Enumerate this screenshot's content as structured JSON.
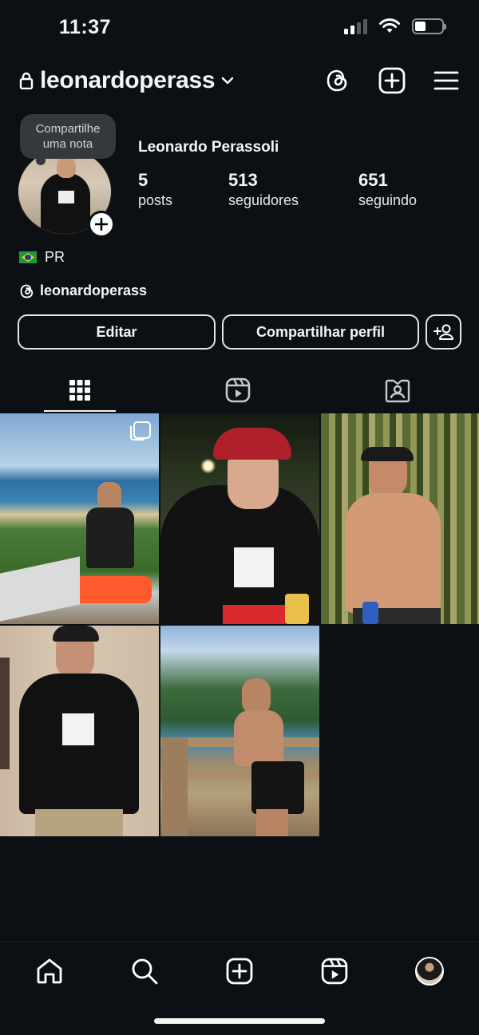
{
  "status_bar": {
    "time": "11:37",
    "icons": [
      "signal-icon",
      "wifi-icon",
      "battery-icon"
    ]
  },
  "header": {
    "username": "leonardoperass",
    "icons": [
      "lock-icon",
      "chevron-down-icon",
      "threads-icon",
      "create-post-icon",
      "menu-icon"
    ]
  },
  "note": {
    "line1": "Compartilhe",
    "line2": "uma nota"
  },
  "profile": {
    "display_name": "Leonardo Perassoli",
    "stats": [
      {
        "value": "5",
        "label": "posts"
      },
      {
        "value": "513",
        "label": "seguidores"
      },
      {
        "value": "651",
        "label": "seguindo"
      }
    ],
    "location": "PR",
    "threads_handle": "leonardoperass"
  },
  "actions": {
    "edit": "Editar",
    "share": "Compartilhar perfil"
  },
  "tabs": [
    "grid-icon",
    "reels-icon",
    "tagged-icon"
  ],
  "posts": [
    {
      "icon": "multi-photo-icon"
    },
    {},
    {},
    {},
    {}
  ],
  "bottom_nav": [
    "home-icon",
    "search-icon",
    "create-icon",
    "reels-icon",
    "profile-avatar"
  ],
  "colors": {
    "background": "#0c1014",
    "text": "#f5f5f5",
    "note_bubble": "#34393e"
  }
}
